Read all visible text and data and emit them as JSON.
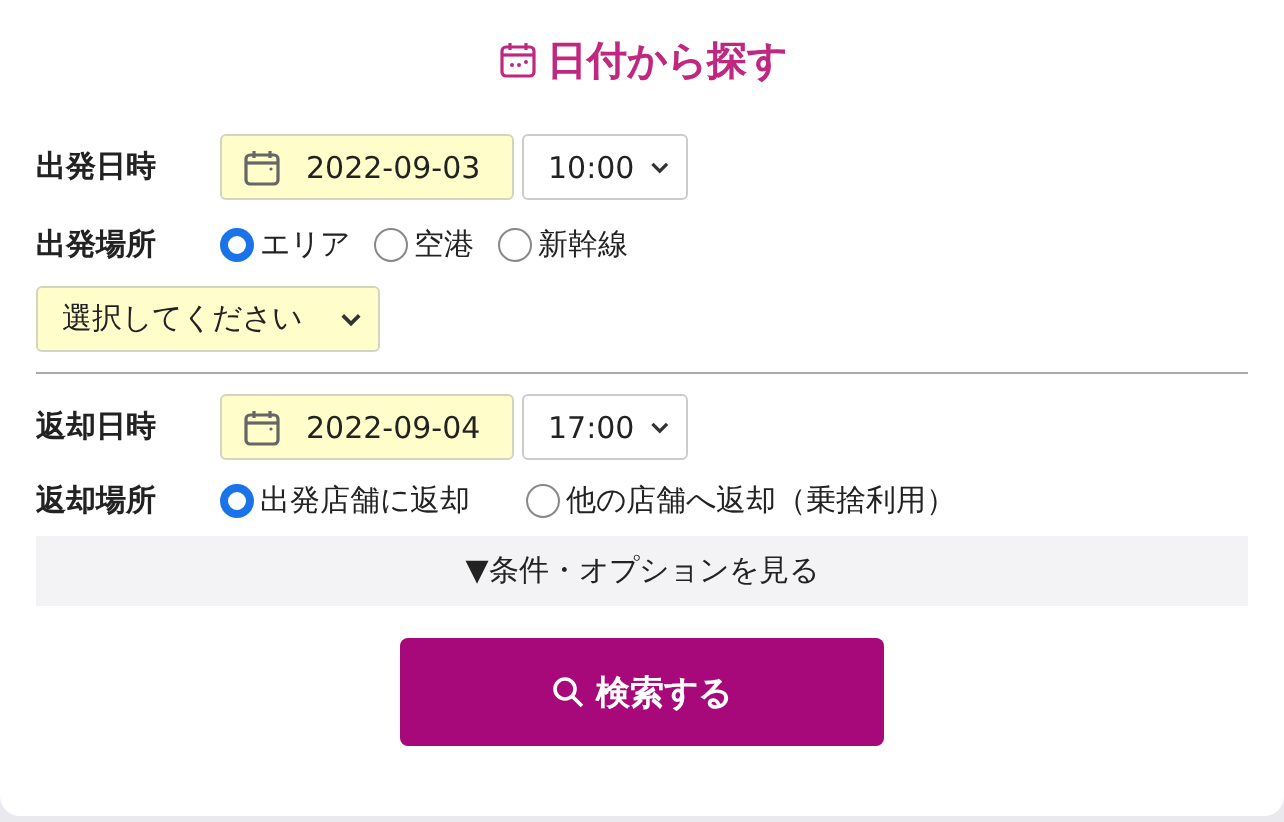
{
  "title": "日付から探す",
  "departure_datetime": {
    "label": "出発日時",
    "date": "2022-09-03",
    "time": "10:00"
  },
  "departure_place": {
    "label": "出発場所",
    "options": [
      {
        "label": "エリア",
        "selected": true
      },
      {
        "label": "空港",
        "selected": false
      },
      {
        "label": "新幹線",
        "selected": false
      }
    ],
    "select": {
      "value": "選択してください"
    }
  },
  "return_datetime": {
    "label": "返却日時",
    "date": "2022-09-04",
    "time": "17:00"
  },
  "return_place": {
    "label": "返却場所",
    "options": [
      {
        "label": "出発店舗に返却",
        "selected": true
      },
      {
        "label": "他の店舗へ返却（乗捨利用）",
        "selected": false
      }
    ]
  },
  "options_toggle": {
    "label": "▼条件・オプションを見る"
  },
  "search_button": {
    "label": "検索する"
  }
}
